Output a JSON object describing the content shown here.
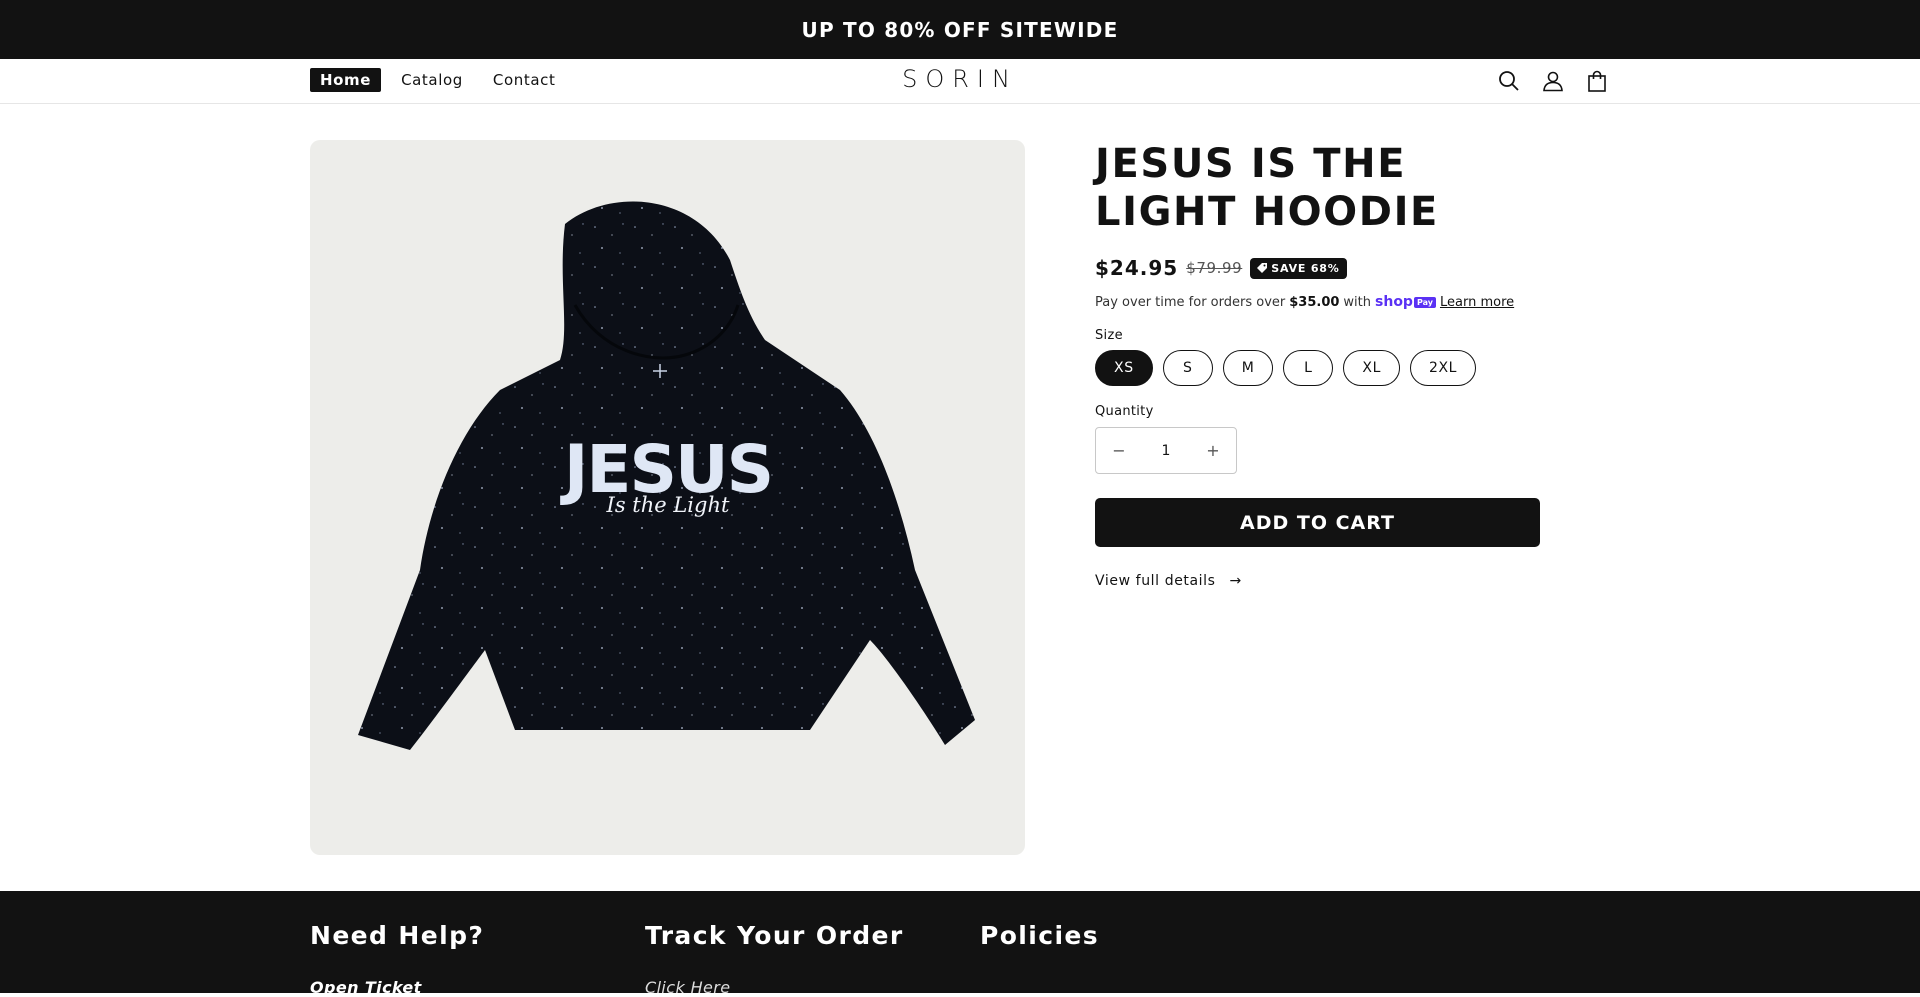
{
  "announcement": {
    "text": "UP TO 80% OFF SITEWIDE"
  },
  "header": {
    "nav": [
      {
        "label": "Home",
        "active": true
      },
      {
        "label": "Catalog",
        "active": false
      },
      {
        "label": "Contact",
        "active": false
      }
    ],
    "logo": "SORIN",
    "icons": [
      "search-icon",
      "account-icon",
      "cart-icon"
    ]
  },
  "product": {
    "image_alt_text": "JESUS Is the Light",
    "title": "JESUS IS THE LIGHT HOODIE",
    "price": "$24.95",
    "compare_price": "$79.99",
    "badge": "SAVE 68%",
    "installments": {
      "prefix": "Pay over time for orders over",
      "amount": "$35.00",
      "suffix": "with",
      "provider": "shop",
      "provider_badge": "Pay",
      "link": "Learn more"
    },
    "size_label": "Size",
    "sizes": [
      "XS",
      "S",
      "M",
      "L",
      "XL",
      "2XL"
    ],
    "selected_size": "XS",
    "quantity_label": "Quantity",
    "quantity": "1",
    "decrement": "−",
    "increment": "+",
    "add_to_cart": "ADD TO CART",
    "view_details": "View full details",
    "details_arrow": "→"
  },
  "footer": {
    "columns": [
      {
        "heading": "Need Help?",
        "link": "Open Ticket"
      },
      {
        "heading": "Track Your Order",
        "link": "Click Here"
      },
      {
        "heading": "Policies",
        "link": ""
      }
    ]
  },
  "colors": {
    "dark": "#121212",
    "image_bg": "#ededea",
    "shop_pay": "#5a31f4"
  }
}
